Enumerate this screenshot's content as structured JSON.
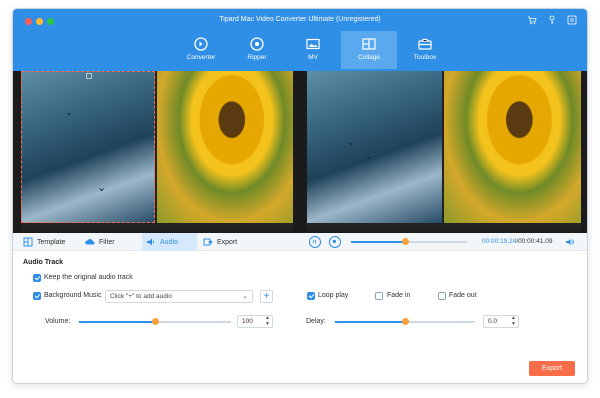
{
  "window": {
    "title": "Tipard Mac Video Converter Ultimate (Unregistered)"
  },
  "header_icons": [
    "cart-icon",
    "key-icon",
    "menu-icon"
  ],
  "nav": {
    "items": [
      {
        "label": "Converter",
        "icon": "converter-icon"
      },
      {
        "label": "Ripper",
        "icon": "ripper-icon"
      },
      {
        "label": "MV",
        "icon": "mv-icon"
      },
      {
        "label": "Collage",
        "icon": "collage-icon",
        "active": true
      },
      {
        "label": "Toolbox",
        "icon": "toolbox-icon"
      }
    ]
  },
  "tabs": [
    {
      "label": "Template",
      "icon": "template-icon"
    },
    {
      "label": "Filter",
      "icon": "filter-icon"
    },
    {
      "label": "Audio",
      "icon": "audio-icon",
      "active": true
    },
    {
      "label": "Export",
      "icon": "export-icon"
    }
  ],
  "playback": {
    "current_time": "00:00:19.24",
    "total_time": "/00:00:41.09",
    "progress_percent": 47
  },
  "audio": {
    "heading": "Audio Track",
    "keep_original_label": "Keep the original audio track",
    "keep_original_checked": true,
    "background_music_label": "Background Music",
    "background_music_checked": true,
    "music_select_value": "Click \"+\" to add audio",
    "loop_play_label": "Loop play",
    "loop_play_checked": true,
    "fade_in_label": "Fade in",
    "fade_in_checked": false,
    "fade_out_label": "Fade out",
    "fade_out_checked": false,
    "volume_label": "Volume:",
    "volume_value": "100",
    "volume_percent": 50,
    "delay_label": "Delay:",
    "delay_value": "0.0",
    "delay_percent": 50
  },
  "export_button_label": "Export",
  "colors": {
    "accent": "#2f8fe6",
    "export": "#f76d4a",
    "knob": "#f7a23a"
  }
}
